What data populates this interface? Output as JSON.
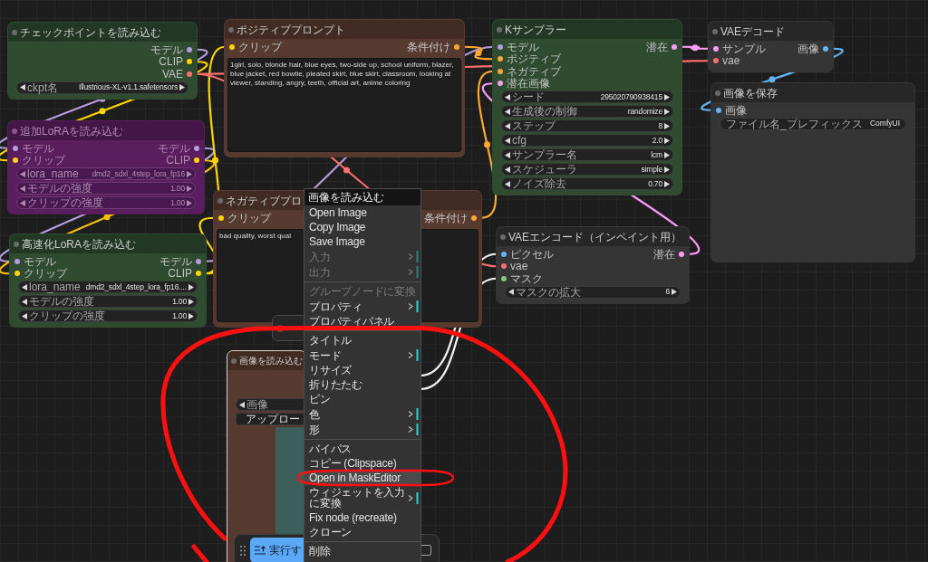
{
  "nodes": [
    {
      "title": "チェックポイントを読み込む",
      "color": "#2f4b30",
      "bypassed": false,
      "selected": false,
      "outputs": [
        {
          "label": "モデル",
          "color": "#b39ddb"
        },
        {
          "label": "CLIP",
          "color": "#ffd500"
        },
        {
          "label": "VAE",
          "color": "#ff6e6e"
        }
      ],
      "widgets": [
        {
          "kind": "combo",
          "label": "ckpt名",
          "value": "Illustrious-XL-v1.1.safetensors"
        }
      ]
    },
    {
      "title": "追加LoRAを読み込む",
      "color": "#5a1e5f",
      "bypassed": true,
      "selected": false,
      "inputs": [
        {
          "label": "モデル",
          "color": "#b39ddb"
        },
        {
          "label": "クリップ",
          "color": "#ffd500"
        }
      ],
      "outputs": [
        {
          "label": "モデル",
          "color": "#b39ddb"
        },
        {
          "label": "CLIP",
          "color": "#ffd500"
        }
      ],
      "widgets": [
        {
          "kind": "combo",
          "label": "lora_name",
          "value": "dmd2_sdxl_4step_lora_fp16"
        },
        {
          "kind": "combo",
          "label": "モデルの強度",
          "value": "1.00"
        },
        {
          "kind": "combo",
          "label": "クリップの強度",
          "value": "1.00"
        }
      ]
    },
    {
      "title": "高速化LoRAを読み込む",
      "color": "#2f4b30",
      "bypassed": false,
      "selected": false,
      "inputs": [
        {
          "label": "モデル",
          "color": "#b39ddb"
        },
        {
          "label": "クリップ",
          "color": "#ffd500"
        }
      ],
      "outputs": [
        {
          "label": "モデル",
          "color": "#b39ddb"
        },
        {
          "label": "CLIP",
          "color": "#ffd500"
        }
      ],
      "widgets": [
        {
          "kind": "combo",
          "label": "lora_name",
          "value": "dmd2_sdxl_4step_lora_fp16...."
        },
        {
          "kind": "combo",
          "label": "モデルの強度",
          "value": "1.00"
        },
        {
          "kind": "combo",
          "label": "クリップの強度",
          "value": "1.00"
        }
      ]
    },
    {
      "title": "ポジティブプロンプト",
      "color": "#573a2f",
      "bypassed": false,
      "selected": false,
      "inputs": [
        {
          "label": "クリップ",
          "color": "#ffd500"
        }
      ],
      "outputs": [
        {
          "label": "条件付け",
          "color": "#ffa931"
        }
      ],
      "widgets": [
        {
          "kind": "textarea",
          "value": "1girl, solo, blonde hair, blue eyes, two-side up, school uniform, blazer, blue jacket, red bowtie, pleated skirt, blue skirt, classroom, looking at viewer, standing, angry, teeth, official art, anime coloring"
        }
      ]
    },
    {
      "title": "ネガティブプロ",
      "color": "#573a2f",
      "bypassed": false,
      "selected": false,
      "inputs": [
        {
          "label": "クリップ",
          "color": "#ffd500"
        }
      ],
      "outputs": [
        {
          "label": "条件付け",
          "color": "#ffa931"
        }
      ],
      "widgets": [
        {
          "kind": "textarea",
          "value": "bad quality, worst qual"
        }
      ]
    },
    {
      "title": "画像を読み込む",
      "color": "#573a2f",
      "bypassed": false,
      "selected": true,
      "widgets": [
        {
          "kind": "combo",
          "label": "画像"
        },
        {
          "kind": "button",
          "label": "アップロー"
        },
        {
          "kind": "image"
        }
      ]
    },
    {
      "title": "Kサンプラー",
      "color": "#2f4b30",
      "bypassed": false,
      "selected": false,
      "inputs": [
        {
          "label": "モデル",
          "color": "#b39ddb"
        },
        {
          "label": "ポジティブ",
          "color": "#ffa931"
        },
        {
          "label": "ネガティブ",
          "color": "#ffa931"
        },
        {
          "label": "潜在画像",
          "color": "#ff9cf9"
        }
      ],
      "outputs": [
        {
          "label": "潜在",
          "color": "#ff9cf9"
        }
      ],
      "widgets": [
        {
          "kind": "combo",
          "label": "シード",
          "value": "295020790938415"
        },
        {
          "kind": "combo",
          "label": "生成後の制御",
          "value": "randomize"
        },
        {
          "kind": "combo",
          "label": "ステップ",
          "value": "8"
        },
        {
          "kind": "combo",
          "label": "cfg",
          "value": "2.0"
        },
        {
          "kind": "combo",
          "label": "サンプラー名",
          "value": "lcm"
        },
        {
          "kind": "combo",
          "label": "スケジューラ",
          "value": "simple"
        },
        {
          "kind": "combo",
          "label": "ノイズ除去",
          "value": "0.70"
        }
      ]
    },
    {
      "title": "VAEデコード",
      "color": "#353535",
      "bypassed": false,
      "selected": false,
      "inputs": [
        {
          "label": "サンプル",
          "color": "#ff9cf9"
        },
        {
          "label": "vae",
          "color": "#ff6e6e"
        }
      ],
      "outputs": [
        {
          "label": "画像",
          "color": "#64b5f6"
        }
      ]
    },
    {
      "title": "画像を保存",
      "color": "#353535",
      "bypassed": false,
      "selected": false,
      "inputs": [
        {
          "label": "画像",
          "color": "#64b5f6"
        }
      ],
      "widgets": [
        {
          "kind": "field",
          "label": "ファイル名_プレフィックス",
          "value": "ComfyUI"
        }
      ]
    },
    {
      "title": "VAEエンコード（インペイント用）",
      "color": "#353535",
      "bypassed": false,
      "selected": false,
      "inputs": [
        {
          "label": "ピクセル",
          "color": "#64b5f6"
        },
        {
          "label": "vae",
          "color": "#ff6e6e"
        },
        {
          "label": "マスク",
          "color": "#81c784"
        }
      ],
      "outputs": [
        {
          "label": "潜在",
          "color": "#ff9cf9"
        }
      ],
      "widgets": [
        {
          "kind": "combo",
          "label": "マスクの拡大",
          "value": "6"
        }
      ]
    }
  ],
  "context_menu": {
    "title": "画像を読み込む",
    "items": [
      {
        "kind": "item",
        "label": "Open Image",
        "disabled": false,
        "submenu": false,
        "selected": false
      },
      {
        "kind": "item",
        "label": "Copy Image",
        "disabled": false,
        "submenu": false,
        "selected": false
      },
      {
        "kind": "item",
        "label": "Save Image",
        "disabled": false,
        "submenu": false,
        "selected": false
      },
      {
        "kind": "item",
        "label": "入力",
        "disabled": true,
        "submenu": true,
        "selected": false
      },
      {
        "kind": "item",
        "label": "出力",
        "disabled": true,
        "submenu": true,
        "selected": false
      },
      {
        "kind": "divider"
      },
      {
        "kind": "item",
        "label": "グループノードに変換",
        "disabled": true,
        "submenu": false,
        "selected": false
      },
      {
        "kind": "item",
        "label": "プロパティ",
        "disabled": false,
        "submenu": true,
        "selected": false
      },
      {
        "kind": "item",
        "label": "プロパティパネル",
        "disabled": false,
        "submenu": false,
        "selected": false
      },
      {
        "kind": "divider"
      },
      {
        "kind": "item",
        "label": "タイトル",
        "disabled": false,
        "submenu": false,
        "selected": false
      },
      {
        "kind": "item",
        "label": "モード",
        "disabled": false,
        "submenu": true,
        "selected": false
      },
      {
        "kind": "item",
        "label": "リサイズ",
        "disabled": false,
        "submenu": false,
        "selected": false
      },
      {
        "kind": "item",
        "label": "折りたたむ",
        "disabled": false,
        "submenu": false,
        "selected": false
      },
      {
        "kind": "item",
        "label": "ピン",
        "disabled": false,
        "submenu": false,
        "selected": false
      },
      {
        "kind": "item",
        "label": "色",
        "disabled": false,
        "submenu": true,
        "selected": false
      },
      {
        "kind": "item",
        "label": "形",
        "disabled": false,
        "submenu": true,
        "selected": false
      },
      {
        "kind": "divider"
      },
      {
        "kind": "item",
        "label": "バイパス",
        "disabled": false,
        "submenu": false,
        "selected": false
      },
      {
        "kind": "item",
        "label": "コピー (Clipspace)",
        "disabled": false,
        "submenu": false,
        "selected": false
      },
      {
        "kind": "item",
        "label": "Open in MaskEditor",
        "disabled": false,
        "submenu": false,
        "selected": true
      },
      {
        "kind": "item",
        "label": "ウィジェットを入力に変換",
        "disabled": false,
        "submenu": true,
        "selected": false
      },
      {
        "kind": "item",
        "label": "Fix node (recreate)",
        "disabled": false,
        "submenu": false,
        "selected": false
      },
      {
        "kind": "item",
        "label": "クローン",
        "disabled": false,
        "submenu": false,
        "selected": false
      },
      {
        "kind": "divider"
      },
      {
        "kind": "item",
        "label": "削除",
        "disabled": false,
        "submenu": false,
        "selected": false
      }
    ]
  },
  "toolbar": {
    "run_button": "実行す"
  }
}
